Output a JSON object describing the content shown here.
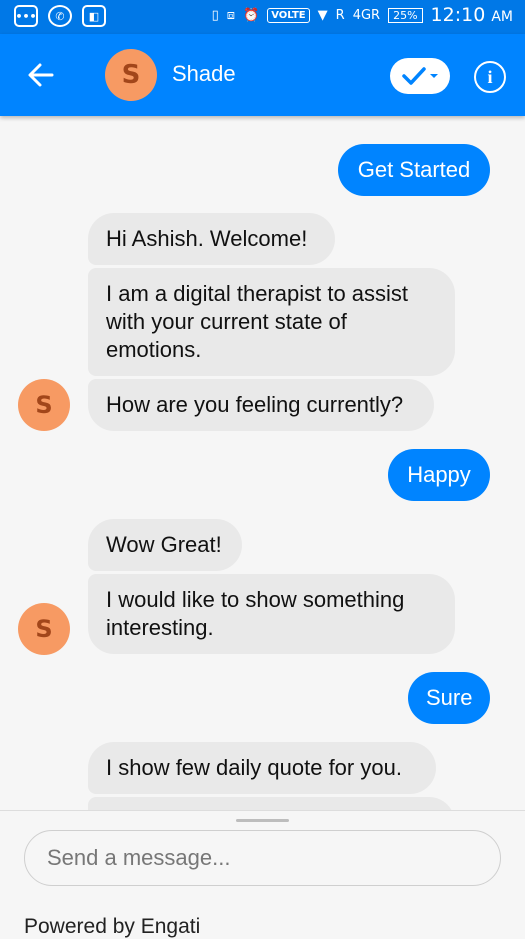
{
  "status_bar": {
    "volte": "VOLTE",
    "signal_r": "R",
    "signal_4g": "4GR",
    "battery": "25%",
    "time": "12:10",
    "ampm": "AM"
  },
  "header": {
    "avatar_letter": "S",
    "title": "Shade"
  },
  "messages": {
    "m1": "Get Started",
    "m2": "Hi Ashish. Welcome!",
    "m3": "I am a digital therapist to assist with your current state of emotions.",
    "m4": "How are you feeling currently?",
    "m5": "Happy",
    "m6": "Wow Great!",
    "m7": "I would like to show something interesting.",
    "m8": "Sure",
    "m9": "I show few daily quote for you."
  },
  "avatar_letter": "S",
  "composer": {
    "placeholder": "Send a message...",
    "powered_by": "Powered by Engati"
  },
  "colors": {
    "brand": "#0084ff",
    "bot_bubble": "#e9e9e9",
    "avatar": "#f79a63"
  }
}
